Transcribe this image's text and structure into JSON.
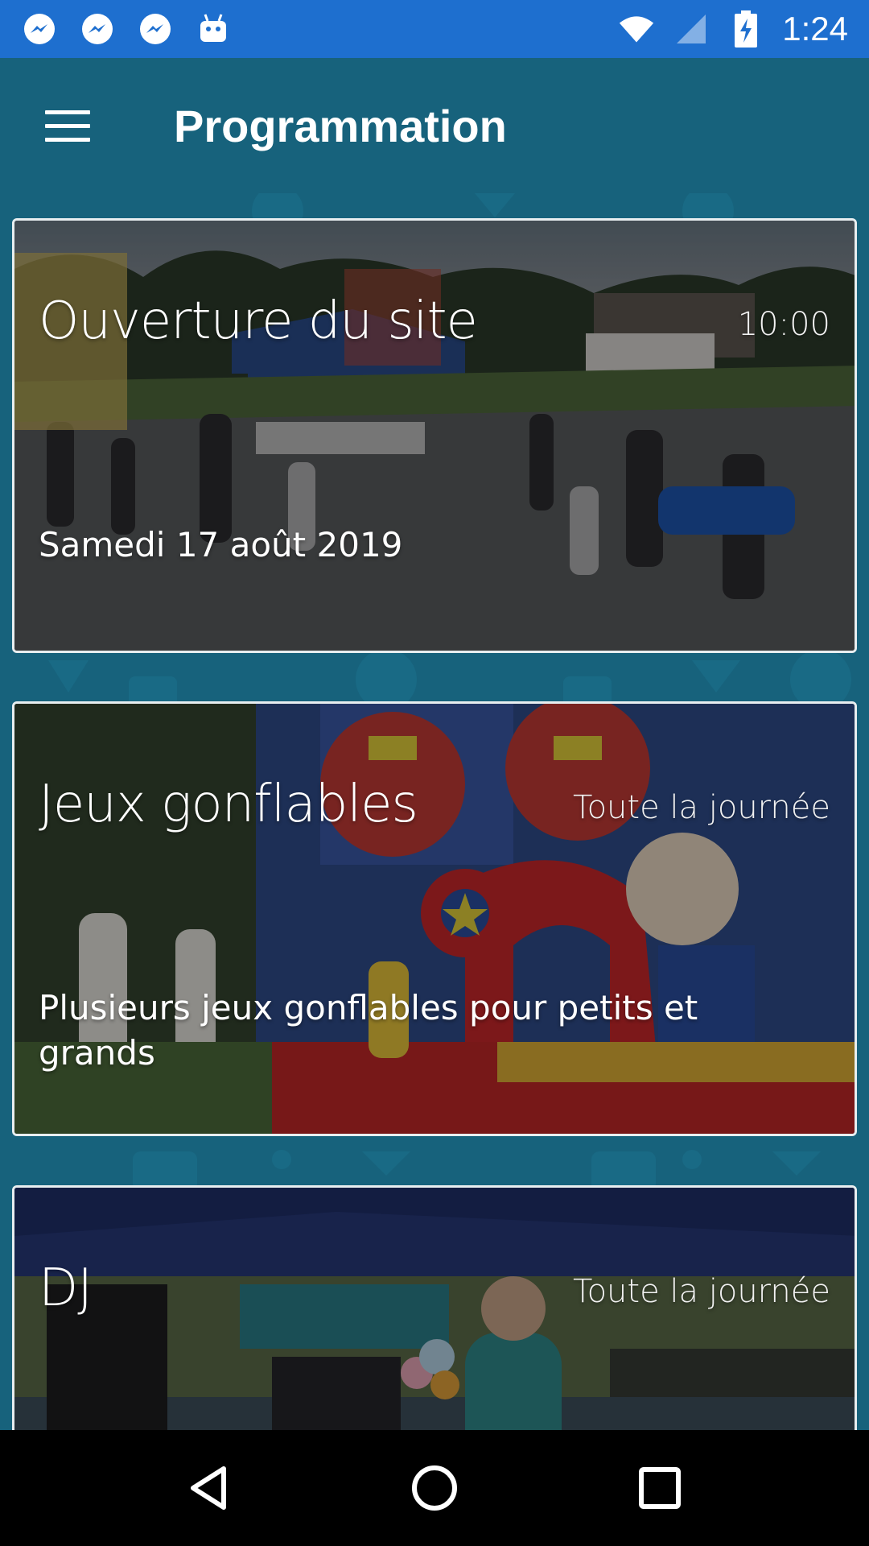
{
  "status_bar": {
    "time": "1:24",
    "left_icons": [
      "messenger-icon",
      "messenger-icon",
      "messenger-icon",
      "android-icon"
    ],
    "right_icons": [
      "wifi-icon",
      "signal-icon",
      "battery-charging-icon"
    ]
  },
  "app_bar": {
    "title": "Programmation",
    "menu_icon": "hamburger-menu-icon"
  },
  "events": [
    {
      "title": "Ouverture du site",
      "time": "10:00",
      "description": "Samedi 17 août 2019",
      "image": "festival-crowd-photo"
    },
    {
      "title": "Jeux gonflables",
      "time": "Toute la journée",
      "description": "Plusieurs jeux gonflables pour petits et grands",
      "image": "bouncy-castle-photo"
    },
    {
      "title": "DJ",
      "time": "Toute la journée",
      "description": "",
      "image": "dj-tent-photo"
    }
  ],
  "nav_bar": {
    "buttons": [
      "back-icon",
      "home-icon",
      "recents-icon"
    ]
  },
  "colors": {
    "status_bar": "#1e6fcf",
    "app_bar": "#17627c",
    "background": "#17627c",
    "card_border": "#e8eef0"
  }
}
